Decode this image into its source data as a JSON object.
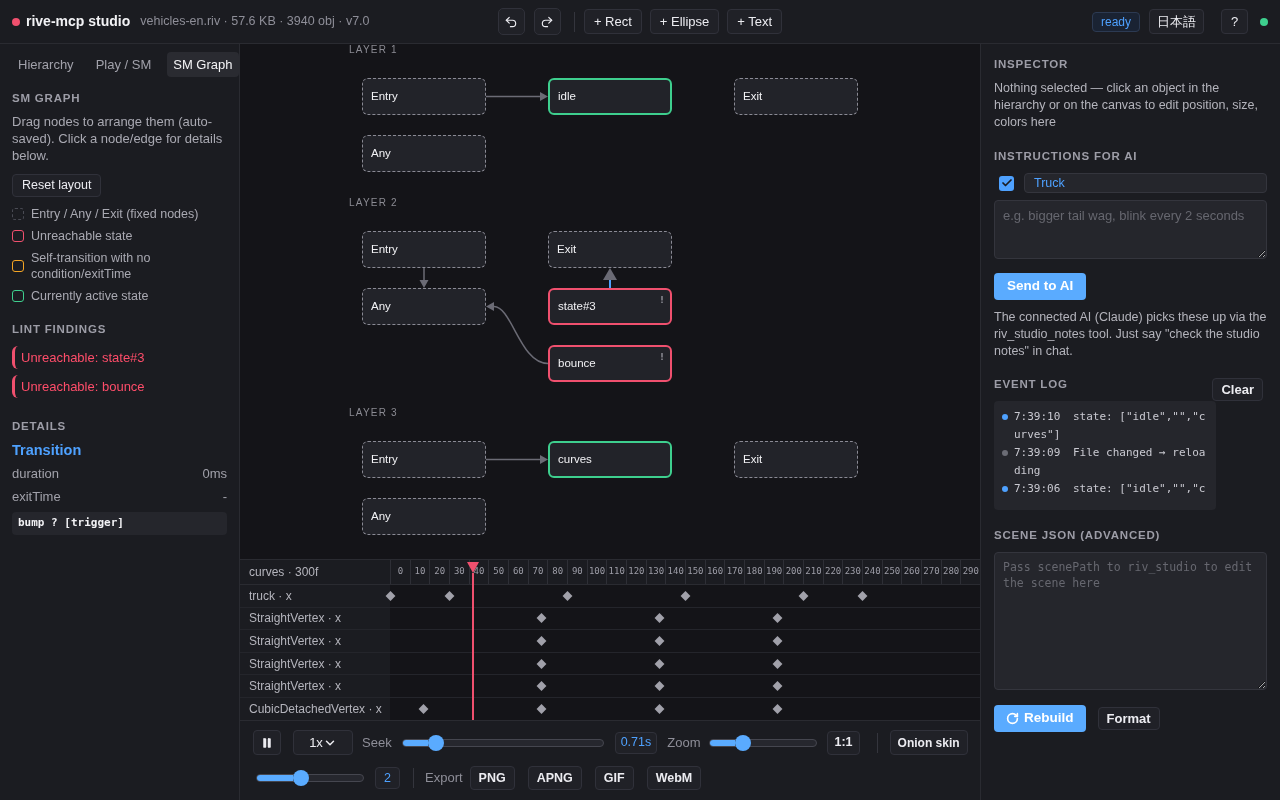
{
  "app": {
    "title": "rive-mcp studio",
    "file_info": "vehicles-en.riv · 57.6 KB · 3940 obj · v7.0",
    "status": "ready",
    "language_button": "日本語",
    "help_button": "?",
    "connected": true
  },
  "toolbar": {
    "add_buttons": [
      "+ Rect",
      "+ Ellipse",
      "+ Text"
    ]
  },
  "left_panel": {
    "tabs": [
      {
        "label": "Hierarchy",
        "selected": false
      },
      {
        "label": "Play / SM",
        "selected": false
      },
      {
        "label": "SM Graph",
        "selected": true
      }
    ],
    "heading": "SM GRAPH",
    "description": "Drag nodes to arrange them (auto-saved). Click a node/edge for details below.",
    "reset_button": "Reset layout",
    "legend": [
      {
        "label": "Entry / Any / Exit (fixed nodes)",
        "kind": "fixed"
      },
      {
        "label": "Unreachable state",
        "kind": "unreachable"
      },
      {
        "label": "Self-transition with no condition/exitTime",
        "kind": "self_transition"
      },
      {
        "label": "Currently active state",
        "kind": "active"
      }
    ],
    "lint_heading": "LINT FINDINGS",
    "lint_findings": [
      "Unreachable: state#3",
      "Unreachable: bounce"
    ],
    "details_heading": "DETAILS",
    "details_title": "Transition",
    "details_rows": [
      {
        "label": "duration",
        "value": "0ms"
      },
      {
        "label": "exitTime",
        "value": "-"
      }
    ],
    "condition": "bump ? [trigger]"
  },
  "graph": {
    "layers": [
      {
        "label": "LAYER 1",
        "columns": [
          {
            "nodes": [
              {
                "label": "Entry",
                "kind": "fixed",
                "transition": {
                  "kind": "right",
                  "selected": false
                }
              },
              {
                "label": "Any",
                "kind": "fixed"
              }
            ]
          },
          {
            "nodes": [
              {
                "label": "idle",
                "kind": "active"
              }
            ]
          },
          {
            "nodes": [
              {
                "label": "Exit",
                "kind": "fixed"
              }
            ]
          }
        ]
      },
      {
        "label": "LAYER 2",
        "columns": [
          {
            "nodes": [
              {
                "label": "Entry",
                "kind": "fixed",
                "transition": {
                  "kind": "down",
                  "selected": false
                }
              },
              {
                "label": "Any",
                "kind": "fixed"
              }
            ]
          },
          {
            "nodes": [
              {
                "label": "Exit",
                "kind": "fixed"
              },
              {
                "label": "state#3",
                "kind": "unreachable",
                "transition": {
                  "kind": "up",
                  "selected": true
                }
              },
              {
                "label": "bounce",
                "kind": "unreachable",
                "transition": {
                  "kind": "up_left",
                  "selected": false
                }
              }
            ]
          }
        ]
      },
      {
        "label": "LAYER 3",
        "columns": [
          {
            "nodes": [
              {
                "label": "Entry",
                "kind": "fixed",
                "transition": {
                  "kind": "right",
                  "selected": false
                }
              },
              {
                "label": "Any",
                "kind": "fixed"
              }
            ]
          },
          {
            "nodes": [
              {
                "label": "curves",
                "kind": "active"
              }
            ]
          },
          {
            "nodes": [
              {
                "label": "Exit",
                "kind": "fixed"
              }
            ]
          }
        ]
      }
    ]
  },
  "timeline": {
    "title": "curves · 300f",
    "ruler": [
      "0",
      "10",
      "20",
      "30",
      "40",
      "50",
      "60",
      "70",
      "80",
      "90",
      "100",
      "110",
      "120",
      "130",
      "140",
      "150",
      "160",
      "170",
      "180",
      "190",
      "200",
      "210",
      "220",
      "230",
      "240",
      "250",
      "260",
      "270",
      "280",
      "290"
    ],
    "playhead": {
      "level": 0.141
    },
    "tracks": [
      {
        "label": "truck · x",
        "keys": [
          {
            "level": 0
          },
          {
            "level": 0.1
          },
          {
            "level": 0.3
          },
          {
            "level": 0.5
          },
          {
            "level": 0.7
          },
          {
            "level": 0.8
          }
        ]
      },
      {
        "label": "StraightVertex · x",
        "keys": [
          {
            "level": 0.257
          },
          {
            "level": 0.457
          },
          {
            "level": 0.657
          }
        ]
      },
      {
        "label": "StraightVertex · x",
        "keys": [
          {
            "level": 0.257
          },
          {
            "level": 0.457
          },
          {
            "level": 0.657
          }
        ]
      },
      {
        "label": "StraightVertex · x",
        "keys": [
          {
            "level": 0.257
          },
          {
            "level": 0.457
          },
          {
            "level": 0.657
          }
        ]
      },
      {
        "label": "StraightVertex · x",
        "keys": [
          {
            "level": 0.257
          },
          {
            "level": 0.457
          },
          {
            "level": 0.657
          }
        ]
      },
      {
        "label": "CubicDetachedVertex · x",
        "keys": [
          {
            "level": 0.057
          },
          {
            "level": 0.257
          },
          {
            "level": 0.457
          },
          {
            "level": 0.657
          }
        ]
      }
    ]
  },
  "playback": {
    "playing": true,
    "speed": "1x",
    "seek_label": "Seek",
    "seek": {
      "level": 0.166
    },
    "time": "0.71s",
    "zoom_label": "Zoom",
    "zoom": {
      "level": 0.306
    },
    "reset_zoom_button": "1:1",
    "onion_button": "Onion skin",
    "count_slider": {
      "level": 0.416
    },
    "count_value": "2",
    "export_label": "Export",
    "export_buttons": [
      "PNG",
      "APNG",
      "GIF",
      "WebM"
    ]
  },
  "inspector": {
    "heading": "INSPECTOR",
    "message": "Nothing selected — click an object in the hierarchy or on the canvas to edit position, size, colors here"
  },
  "ai_instructions": {
    "heading": "INSTRUCTIONS FOR AI",
    "target": {
      "checked": true,
      "value": "Truck"
    },
    "note_field": {
      "placeholder": "e.g. bigger tail wag, blink every 2 seconds"
    },
    "send_button": "Send to AI",
    "help": "The connected AI (Claude) picks these up via the riv_studio_notes tool. Just say \"check the studio notes\" in chat."
  },
  "event_log": {
    "heading": "EVENT LOG",
    "clear_button": "Clear",
    "entries": [
      {
        "time": "7:39:10",
        "message": "state: [\"idle\",\"\",\"curves\"]",
        "color": "#4ea1ff"
      },
      {
        "time": "7:39:09",
        "message": "File changed → reloading",
        "color": "#6b6c75"
      },
      {
        "time": "7:39:06",
        "message": "state: [\"idle\",\"\",\"c",
        "color": "#4ea1ff"
      }
    ]
  },
  "scene_json": {
    "heading": "SCENE JSON (ADVANCED)",
    "editor": {
      "placeholder": "Pass scenePath to riv_studio to edit the scene here"
    },
    "rebuild_button": "Rebuild",
    "format_button": "Format"
  }
}
